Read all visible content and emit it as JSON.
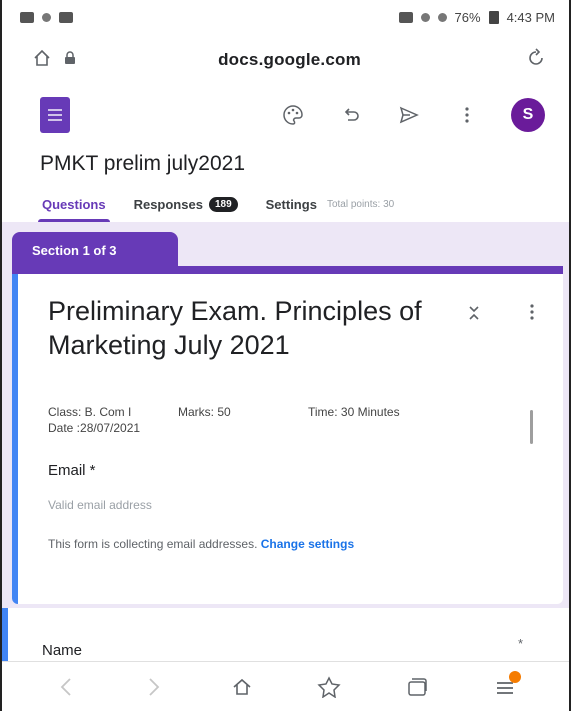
{
  "status_bar": {
    "battery": "76%",
    "time": "4:43 PM"
  },
  "browser": {
    "url": "docs.google.com"
  },
  "toolbar": {
    "avatar_initial": "S"
  },
  "form": {
    "title": "PMKT prelim july2021",
    "tabs": {
      "questions": "Questions",
      "responses": "Responses",
      "responses_count": "189",
      "settings": "Settings",
      "total_points": "Total points: 30"
    }
  },
  "section": {
    "tab_label": "Section 1 of 3",
    "title": "Preliminary Exam. Principles of Marketing July 2021",
    "class": "Class: B. Com I",
    "marks": "Marks: 50",
    "time": "Time: 30 Minutes",
    "date": "Date :28/07/2021",
    "email_label": "Email *",
    "email_placeholder": "Valid email address",
    "collecting_note": "This form is collecting email addresses.",
    "change_settings": "Change settings"
  },
  "question": {
    "label": "Name",
    "required_mark": "*"
  },
  "colors": {
    "brand_purple": "#673ab7",
    "background_lavender": "#ede7f6",
    "focus_blue": "#4285f4",
    "link_blue": "#1a73e8",
    "notification_orange": "#f57c00"
  }
}
